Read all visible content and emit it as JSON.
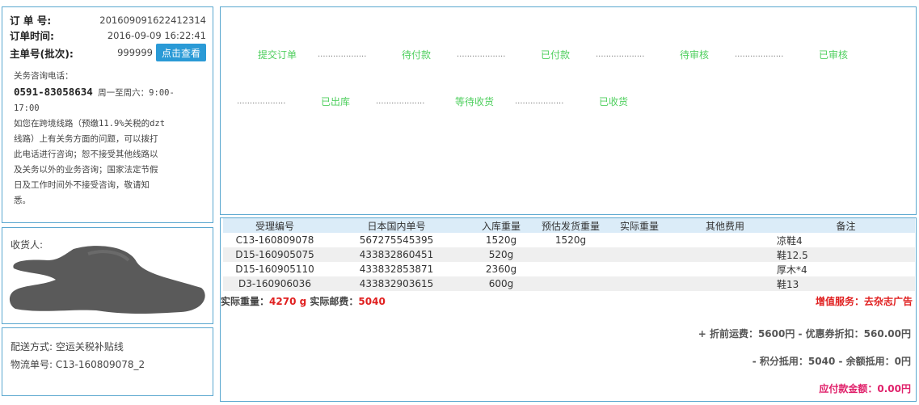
{
  "order": {
    "order_no_label": "订 单 号:",
    "order_no": "201609091622412314",
    "order_time_label": "订单时间:",
    "order_time": "2016-09-09 16:22:41",
    "batch_label": "主单号(批次):",
    "batch_no": "999999",
    "view_button": "点击查看"
  },
  "consult": {
    "title": "关务咨询电话：",
    "phone": "0591-83058634",
    "hours": "周一至周六：9:00-",
    "hours_end": "17:00",
    "note_lines": [
      "如您在跨境线路（预缴11.9%关税的dzt",
      "线路）上有关务方面的问题，可以拨打",
      "此电话进行咨询；恕不接受其他线路以",
      "及关务以外的业务咨询；国家法定节假",
      "日及工作时间外不接受咨询，敬请知",
      "悉。"
    ]
  },
  "consignee": {
    "label": "收货人:"
  },
  "shipping": {
    "method_label": "配送方式: 空运关税补贴线",
    "tracking_label": "物流单号: C13-160809078_2"
  },
  "status": {
    "steps": [
      "提交订单",
      "待付款",
      "已付款",
      "待审核",
      "已审核",
      "已出库",
      "等待收货",
      "已收货"
    ],
    "separator": "...................",
    "color": "#4fcf5e"
  },
  "items": {
    "headers": [
      "受理编号",
      "日本国内单号",
      "入库重量",
      "预估发货重量",
      "实际重量",
      "其他费用",
      "备注"
    ],
    "rows": [
      [
        "C13-160809078",
        "567275545395",
        "1520g",
        "1520g",
        "",
        "",
        "凉鞋4"
      ],
      [
        "D15-160905075",
        "433832860451",
        "520g",
        "",
        "",
        "",
        "鞋12.5"
      ],
      [
        "D15-160905110",
        "433832853871",
        "2360g",
        "",
        "",
        "",
        "厚木*4"
      ],
      [
        "D3-160906036",
        "433832903615",
        "600g",
        "",
        "",
        "",
        "鞋13"
      ]
    ],
    "actual_weight_label": "实际重量：",
    "actual_weight": "4270 g",
    "actual_postage_label": "实际邮费：",
    "actual_postage": "5040",
    "value_added": "增值服务：去杂志广告",
    "fee_line_1": "+ 折前运费：5600円 - 优惠券折扣：560.00円",
    "fee_line_2": "- 积分抵用：5040 - 余额抵用：0円",
    "amount_due": "应付款金额：0.00円"
  }
}
